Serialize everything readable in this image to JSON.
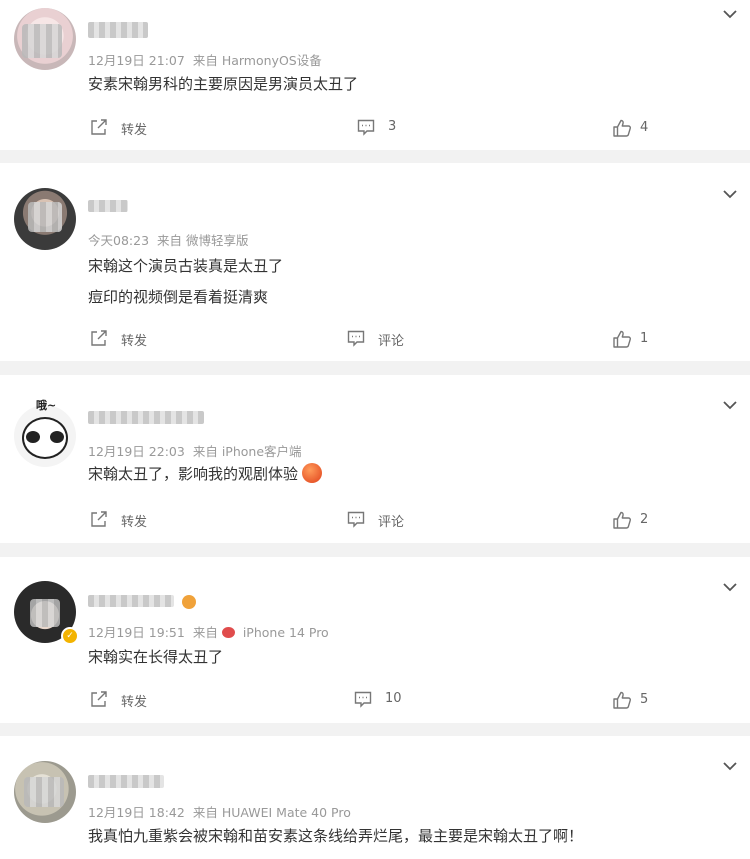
{
  "comments": [
    {
      "time": "12月19日 21:07",
      "source_prefix": "来自",
      "source": "HarmonyOS设备",
      "lines": [
        "安素宋翰男科的主要原因是男演员太丑了"
      ],
      "repost_label": "转发",
      "comment_label": "3",
      "like_count": "4"
    },
    {
      "time": "今天08:23",
      "source_prefix": "来自",
      "source": "微博轻享版",
      "lines": [
        "宋翰这个演员古装真是太丑了",
        "痘印的视频倒是看着挺清爽"
      ],
      "repost_label": "转发",
      "comment_label": "评论",
      "like_count": "1"
    },
    {
      "avatar_caption": "哦~",
      "time": "12月19日 22:03",
      "source_prefix": "来自",
      "source": "iPhone客户端",
      "lines": [
        "宋翰太丑了，影响我的观剧体验"
      ],
      "repost_label": "转发",
      "comment_label": "评论",
      "like_count": "2"
    },
    {
      "time": "12月19日 19:51",
      "source_prefix": "来自",
      "source": "iPhone 14 Pro",
      "lines": [
        "宋翰实在长得太丑了"
      ],
      "repost_label": "转发",
      "comment_label": "10",
      "like_count": "5"
    },
    {
      "time": "12月19日 18:42",
      "source_prefix": "来自",
      "source": "HUAWEI Mate 40 Pro",
      "lines": [
        "我真怕九重紫会被宋翰和苗安素这条线给弄烂尾，最主要是宋翰太丑了啊！"
      ]
    }
  ],
  "icons": {
    "more": "chevron-down-icon",
    "repost": "share-icon",
    "comment": "comment-icon",
    "like": "thumbs-up-icon",
    "verified": "verified-badge-icon",
    "device": "pig-icon",
    "emoji": "angry-emoji-icon"
  },
  "colors": {
    "page_bg": "#f2f2f2",
    "card_bg": "#ffffff",
    "text": "#333333",
    "meta": "#999999",
    "action": "#666666"
  }
}
